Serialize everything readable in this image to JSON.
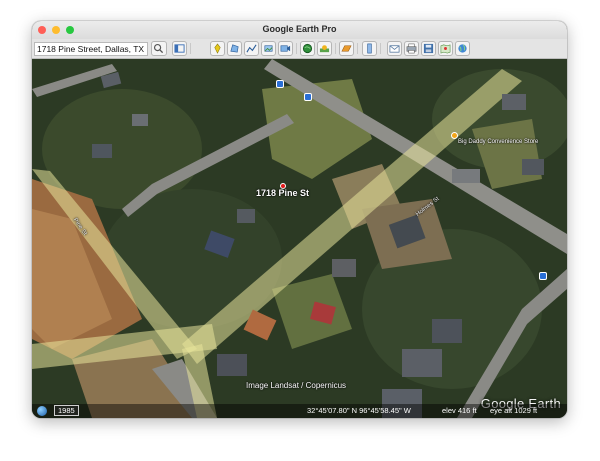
{
  "window": {
    "title": "Google Earth Pro"
  },
  "toolbar": {
    "search_value": "1718 Pine Street, Dallas, TX",
    "buttons": [
      "search-icon",
      "pin-icon",
      "sidebar-icon",
      "placemark-icon",
      "polygon-icon",
      "path-icon",
      "overlay-icon",
      "tour-icon",
      "globe-icon",
      "sun-icon",
      "planets-icon",
      "ruler-icon",
      "email-icon",
      "print-icon",
      "save-image-icon",
      "maps-icon"
    ]
  },
  "map": {
    "address_label": "1718 Pine St",
    "store_label": "Big Daddy Convenience Store",
    "road_labels": [
      "Pine St",
      "Holmes St"
    ],
    "credit": "Image Landsat / Copernicus",
    "logo": "Google Earth"
  },
  "status": {
    "year": "1985",
    "coordinates": "32°45'07.80\" N  96°45'58.45\" W",
    "elev": "elev  416 ft",
    "eye_alt": "eye alt  1029 ft"
  },
  "colors": {
    "road_highlight": "#e8e49a",
    "title_text": "#2b2b2b",
    "transit_icon": "#2a6fd6"
  }
}
